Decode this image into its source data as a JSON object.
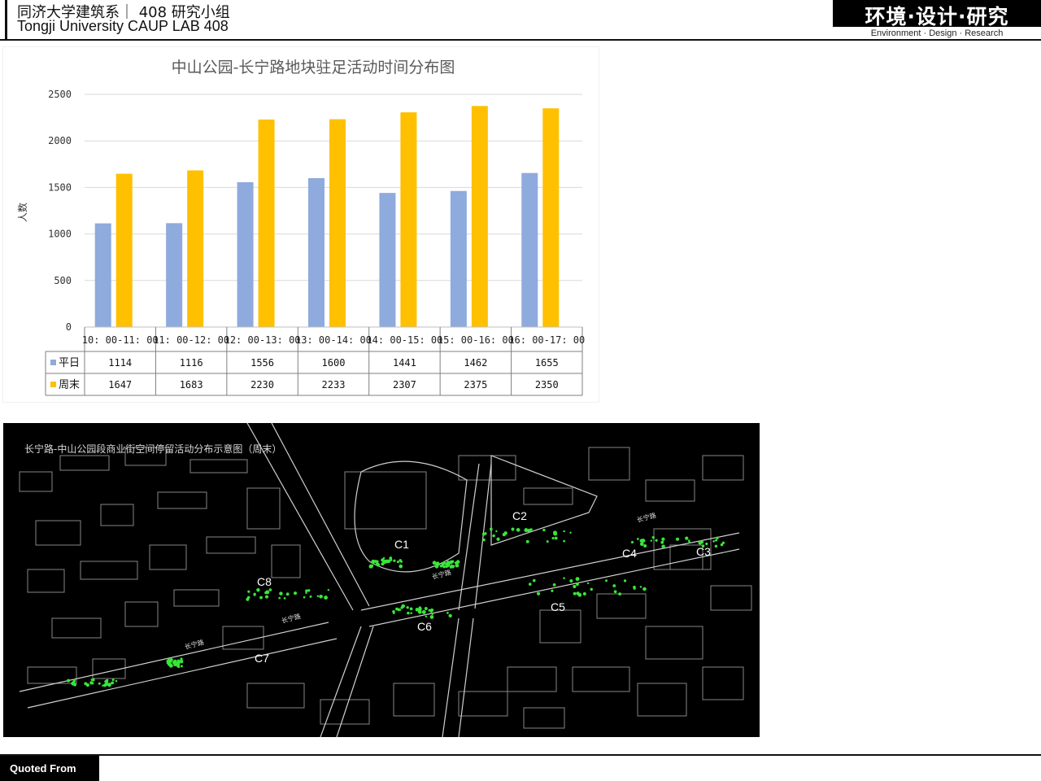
{
  "header": {
    "title_cn": "同济大学建筑系｜ 408 研究小组",
    "title_en": "Tongji University CAUP   LAB 408",
    "logo_cn": "环境·设计·研究",
    "logo_en": "Environment · Design · Research"
  },
  "colors": {
    "weekday": "#8faadc",
    "weekend": "#ffc000",
    "grid": "#d9d9d9",
    "axis_text": "#333333",
    "title_text": "#595959",
    "map_bg": "#000000",
    "map_lines": "#b3b3b3",
    "map_activity": "#39e639"
  },
  "chart_data": {
    "type": "bar",
    "title": "中山公园-长宁路地块驻足活动时间分布图",
    "ylabel": "人数",
    "ylim": [
      0,
      2500
    ],
    "yticks": [
      0,
      500,
      1000,
      1500,
      2000,
      2500
    ],
    "grid": true,
    "categories": [
      "10: 00-11: 00",
      "11: 00-12: 00",
      "12: 00-13: 00",
      "13: 00-14: 00",
      "14: 00-15: 00",
      "15: 00-16: 00",
      "16: 00-17: 00"
    ],
    "series": [
      {
        "name": "平日",
        "values": [
          1114,
          1116,
          1556,
          1600,
          1441,
          1462,
          1655
        ]
      },
      {
        "name": "周末",
        "values": [
          1647,
          1683,
          2230,
          2233,
          2307,
          2375,
          2350
        ]
      }
    ],
    "legend": "data-table"
  },
  "map": {
    "title": "长宁路-中山公园段商业街空间停留活动分布示意图（周末）",
    "zone_labels": [
      "C1",
      "C2",
      "C3",
      "C4",
      "C5",
      "C6",
      "C7",
      "C8"
    ],
    "street_labels": [
      "长宁路",
      "长宁路",
      "长宁路",
      "长宁路"
    ]
  },
  "footer": {
    "label": "Quoted From"
  }
}
